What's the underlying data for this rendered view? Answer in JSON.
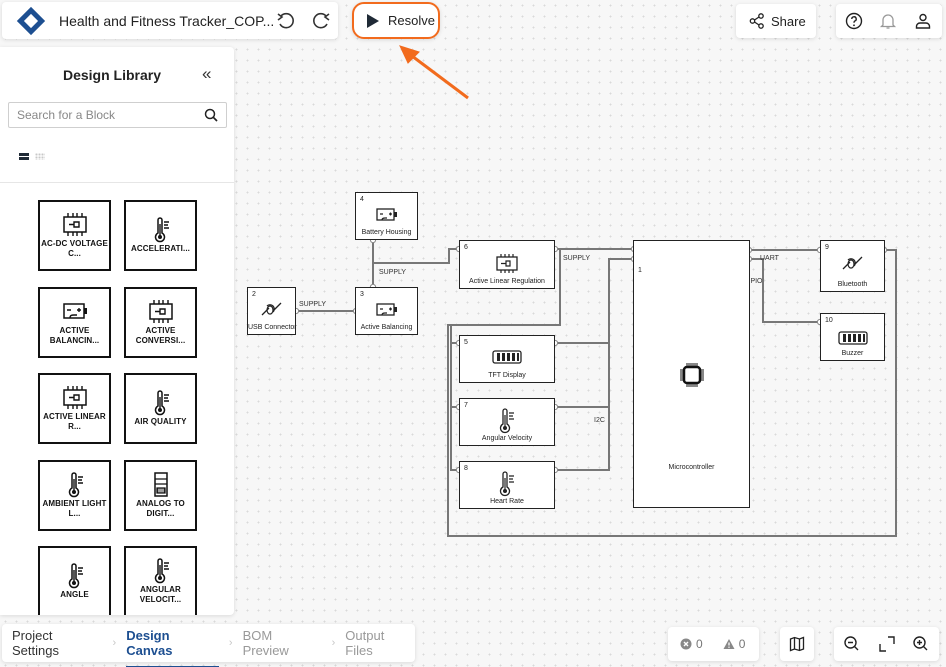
{
  "header": {
    "project_title": "Health and Fitness Tracker_COP...",
    "undo": "undo-icon",
    "redo": "redo-icon",
    "resolve_label": "Resolve",
    "share_label": "Share",
    "icons": [
      "help-icon",
      "bell-icon",
      "user-icon"
    ]
  },
  "colors": {
    "accent": "#1d4f91",
    "highlight": "#f26b1d",
    "play": "#1f2a36"
  },
  "library": {
    "title": "Design Library",
    "collapse_glyph": "«",
    "search_placeholder": "Search for a Block",
    "blocks": [
      {
        "label": "AC-DC VOLTAGE C...",
        "icon": "chip-plug"
      },
      {
        "label": "ACCELERATI...",
        "icon": "thermometer"
      },
      {
        "label": "ACTIVE BALANCIN...",
        "icon": "battery-plug"
      },
      {
        "label": "ACTIVE CONVERSI...",
        "icon": "chip-plug"
      },
      {
        "label": "ACTIVE LINEAR R...",
        "icon": "chip-plug"
      },
      {
        "label": "AIR QUALITY",
        "icon": "thermometer"
      },
      {
        "label": "AMBIENT LIGHT L...",
        "icon": "thermometer"
      },
      {
        "label": "ANALOG TO DIGIT...",
        "icon": "adc-module"
      },
      {
        "label": "ANGLE",
        "icon": "thermometer"
      },
      {
        "label": "ANGULAR VELOCIT...",
        "icon": "thermometer"
      }
    ]
  },
  "diagram": {
    "blocks": [
      {
        "id": "1",
        "label": "Microcontroller",
        "icon": "mcu-chip"
      },
      {
        "id": "2",
        "label": "USB Connector",
        "icon": "cable"
      },
      {
        "id": "3",
        "label": "Active Balancing",
        "icon": "battery-plug"
      },
      {
        "id": "4",
        "label": "Battery Housing",
        "icon": "battery-plug"
      },
      {
        "id": "5",
        "label": "TFT Display",
        "icon": "dip-switch"
      },
      {
        "id": "6",
        "label": "Active Linear Regulation",
        "icon": "chip-plug"
      },
      {
        "id": "7",
        "label": "Angular Velocity",
        "icon": "thermometer"
      },
      {
        "id": "8",
        "label": "Heart Rate",
        "icon": "thermometer"
      },
      {
        "id": "9",
        "label": "Bluetooth",
        "icon": "cable"
      },
      {
        "id": "10",
        "label": "Buzzer",
        "icon": "dip-switch"
      }
    ],
    "net_labels": [
      "SUPPLY",
      "SUPPLY",
      "SUPPLY",
      "I2C",
      "UART",
      "GPIO"
    ]
  },
  "footer": {
    "steps": [
      {
        "label": "Project Settings",
        "state": "done"
      },
      {
        "label": "Design Canvas",
        "state": "active"
      },
      {
        "label": "BOM Preview",
        "state": "todo"
      },
      {
        "label": "Output Files",
        "state": "todo"
      }
    ],
    "step_separator": "›",
    "error_count": "0",
    "warning_count": "0",
    "map_icon": "map-icon",
    "zoom_icons": [
      "zoom-out-icon",
      "fit-screen-icon",
      "zoom-in-icon"
    ]
  }
}
